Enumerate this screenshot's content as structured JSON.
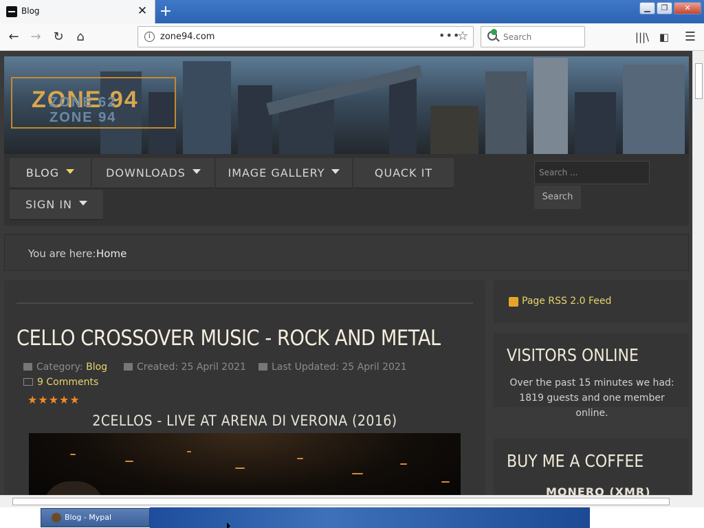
{
  "browser": {
    "tab_title": "Blog",
    "url": "zone94.com",
    "search_placeholder": "Search",
    "new_tab_symbol": "+",
    "tab_close_symbol": "✕"
  },
  "site": {
    "logo_main": "ZONE 94",
    "logo_sub_1": "ZONE 62",
    "logo_sub_2": "ZONE 94",
    "menu": {
      "blog": "BLOG",
      "downloads": "DOWNLOADS",
      "image_gallery": "IMAGE GALLERY",
      "quack_it": "QUACK IT",
      "sign_in": "SIGN IN"
    },
    "search_placeholder": "Search ...",
    "search_button": "Search",
    "breadcrumb_label": "You are here:",
    "breadcrumb_home": "Home"
  },
  "article": {
    "title": "CELLO CROSSOVER MUSIC - ROCK AND METAL",
    "category_label": "Category:",
    "category": "Blog",
    "created": "Created: 25 April 2021",
    "updated": "Last Updated: 25 April 2021",
    "comments": "9 Comments",
    "rating": 5,
    "rating_stars": "★★★★★",
    "video_title": "2CELLOS - LIVE AT ARENA DI VERONA (2016)"
  },
  "sidebar": {
    "rss": "Page RSS 2.0 Feed",
    "visitors_title": "VISITORS ONLINE",
    "visitors_text": "Over the past 15 minutes we had: 1819 guests and one member online.",
    "coffee_title": "BUY ME A COFFEE",
    "coffee_item": "MONERO (XMR)"
  },
  "taskbar": {
    "window_label": "Blog - Mypal"
  }
}
